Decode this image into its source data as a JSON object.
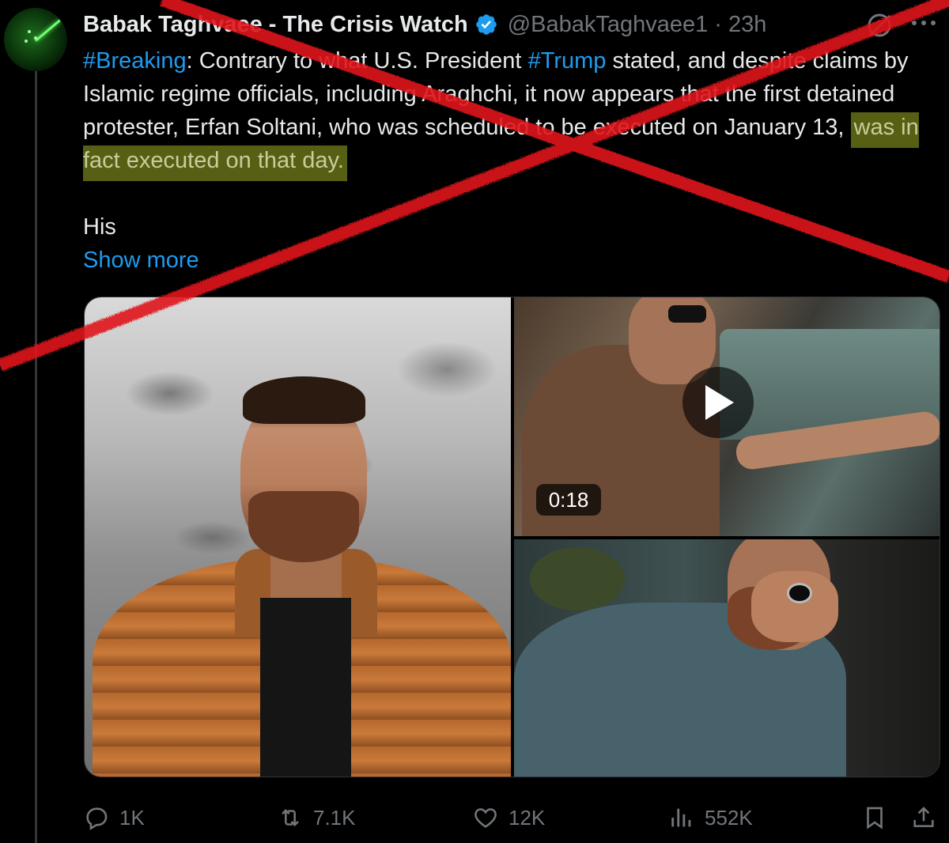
{
  "author": {
    "name": "Babak Taghvaee - The Crisis Watch",
    "handle": "@BabakTaghvaee1",
    "separator": "·",
    "time": "23h",
    "verified": true
  },
  "tweet": {
    "hashtag_breaking": "#Breaking",
    "text_1": ": Contrary to what U.S. President ",
    "hashtag_trump": "#Trump",
    "text_2": " stated, and despite claims by Islamic regime officials, including Araghchi, it now appears that the first detained protester, Erfan Soltani, who was scheduled to be executed on January 13, ",
    "highlighted": "was in fact executed on that day.",
    "para2": "His",
    "show_more": "Show more"
  },
  "media": {
    "video_duration": "0:18"
  },
  "actions": {
    "replies": "1K",
    "reposts": "7.1K",
    "likes": "12K",
    "views": "552K"
  },
  "icons": {
    "avatar": "radar-avatar",
    "verified": "verified-badge-icon",
    "grok": "grok-icon",
    "more": "more-icon",
    "reply": "reply-icon",
    "repost": "repost-icon",
    "like": "heart-icon",
    "views": "views-icon",
    "bookmark": "bookmark-icon",
    "share": "share-icon",
    "play": "play-icon"
  },
  "colors": {
    "link": "#1d9bf0",
    "muted": "#71767b",
    "highlight": "#575f14",
    "strike": "#e0141e"
  }
}
